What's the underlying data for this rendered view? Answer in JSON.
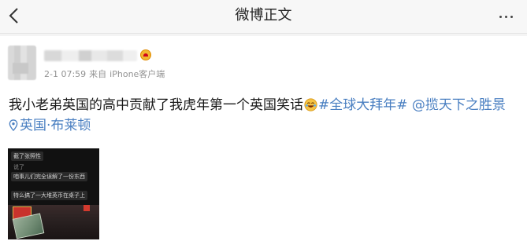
{
  "nav": {
    "title": "微博正文",
    "back_icon": "chevron-left-icon",
    "more_icon": "more-dots-icon"
  },
  "post": {
    "time": "2-1 07:59",
    "source_prefix": "来自",
    "source": "iPhone客户端",
    "text": "我小老弟英国的高中贡献了我虎年第一个英国笑话",
    "hashtag": "#全球大拜年#",
    "mention": "@揽天下之胜景",
    "location": "英国·布莱顿",
    "emoji_icon": "laugh-cry-emoji-icon",
    "location_icon": "location-pin-icon"
  },
  "thumbnail": {
    "lines": [
      "截了张照性",
      "说了",
      "咱事儿们完全误解了一份东西",
      "特么搞了一大堆英币在桌子上"
    ]
  },
  "colors": {
    "link": "#4a7fc1",
    "meta": "#939393",
    "vip": "#f2b632"
  }
}
